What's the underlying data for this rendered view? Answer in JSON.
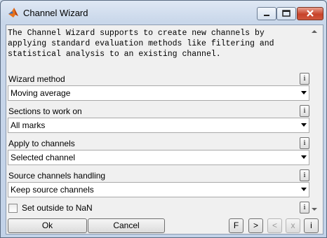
{
  "window": {
    "title": "Channel Wizard"
  },
  "description": "The Channel Wizard supports to create new channels by\napplying standard evaluation methods like filtering and\nstatistical analysis to an existing channel.",
  "fields": [
    {
      "label": "Wizard method",
      "value": "Moving average"
    },
    {
      "label": "Sections to work on",
      "value": "All marks"
    },
    {
      "label": "Apply to channels",
      "value": "Selected channel"
    },
    {
      "label": "Source channels handling",
      "value": "Keep source channels"
    }
  ],
  "info_label": "i",
  "checkbox": {
    "label": "Set outside to NaN",
    "checked": false
  },
  "buttons": {
    "ok": "Ok",
    "cancel": "Cancel",
    "f": "F",
    "next": ">",
    "prev": "<",
    "x": "x",
    "info": "i"
  },
  "colors": {
    "close_button": "#c7432a",
    "accent_icon": "#e8731c"
  },
  "icons": {
    "app": "matlab-logo-icon",
    "minimize": "minimize-icon",
    "maximize": "maximize-icon",
    "close": "close-icon"
  }
}
